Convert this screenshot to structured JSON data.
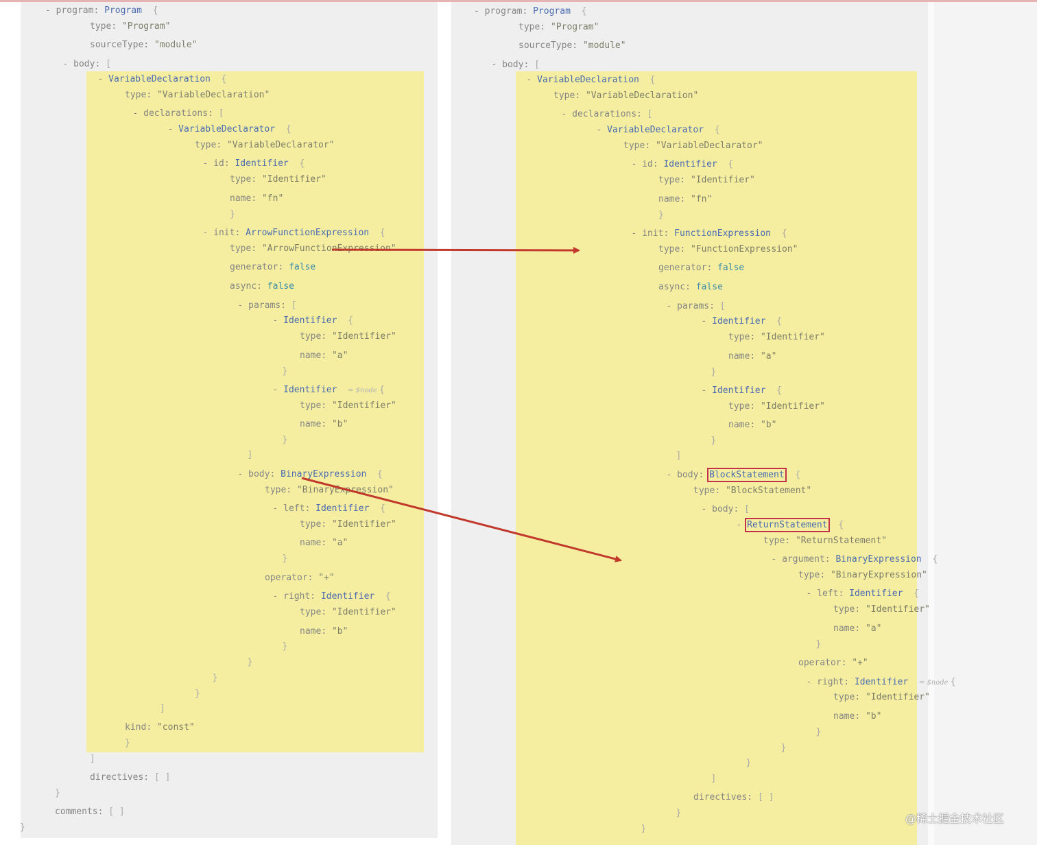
{
  "left_tree": [
    {
      "i": 0,
      "p": "- ",
      "k": "program",
      "t": "Program",
      "b": "{"
    },
    {
      "i": 1,
      "k": "type",
      "s": "\"Program\""
    },
    {
      "i": 1,
      "k": "sourceType",
      "s": "\"module\""
    },
    {
      "i": 0.5,
      "p": "- ",
      "k": "body",
      "b": "["
    },
    {
      "i": 1.5,
      "p": "- ",
      "t": "VariableDeclaration",
      "b": "{"
    },
    {
      "i": 2,
      "k": "type",
      "s": "\"VariableDeclaration\""
    },
    {
      "i": 2.5,
      "p": "- ",
      "k": "declarations",
      "b": "["
    },
    {
      "i": 3.5,
      "p": "- ",
      "t": "VariableDeclarator",
      "b": "{"
    },
    {
      "i": 4,
      "k": "type",
      "s": "\"VariableDeclarator\""
    },
    {
      "i": 4.5,
      "p": "- ",
      "k": "id",
      "t": "Identifier",
      "b": "{"
    },
    {
      "i": 5,
      "k": "type",
      "s": "\"Identifier\""
    },
    {
      "i": 5,
      "k": "name",
      "s": "\"fn\""
    },
    {
      "i": 5,
      "c": "}"
    },
    {
      "i": 4.5,
      "p": "- ",
      "k": "init",
      "t": "ArrowFunctionExpression",
      "b": "{"
    },
    {
      "i": 5,
      "k": "type",
      "s": "\"ArrowFunctionExpression\""
    },
    {
      "i": 5,
      "k": "generator",
      "v": "false"
    },
    {
      "i": 5,
      "k": "async",
      "v": "false"
    },
    {
      "i": 5.5,
      "p": "- ",
      "k": "params",
      "b": "["
    },
    {
      "i": 6.5,
      "p": "- ",
      "t": "Identifier",
      "b": "{"
    },
    {
      "i": 7,
      "k": "type",
      "s": "\"Identifier\""
    },
    {
      "i": 7,
      "k": "name",
      "s": "\"a\""
    },
    {
      "i": 6.5,
      "c": "}"
    },
    {
      "i": 6.5,
      "p": "- ",
      "t": "Identifier",
      "tag": "= $node",
      "b": "{"
    },
    {
      "i": 7,
      "k": "type",
      "s": "\"Identifier\""
    },
    {
      "i": 7,
      "k": "name",
      "s": "\"b\""
    },
    {
      "i": 6.5,
      "c": "}"
    },
    {
      "i": 5.5,
      "c": "]"
    },
    {
      "i": 5.5,
      "p": "- ",
      "k": "body",
      "t": "BinaryExpression",
      "b": "{"
    },
    {
      "i": 6,
      "k": "type",
      "s": "\"BinaryExpression\""
    },
    {
      "i": 6.5,
      "p": "- ",
      "k": "left",
      "t": "Identifier",
      "b": "{"
    },
    {
      "i": 7,
      "k": "type",
      "s": "\"Identifier\""
    },
    {
      "i": 7,
      "k": "name",
      "s": "\"a\""
    },
    {
      "i": 6.5,
      "c": "}"
    },
    {
      "i": 6,
      "k": "operator",
      "s": "\"+\""
    },
    {
      "i": 6.5,
      "p": "- ",
      "k": "right",
      "t": "Identifier",
      "b": "{"
    },
    {
      "i": 7,
      "k": "type",
      "s": "\"Identifier\""
    },
    {
      "i": 7,
      "k": "name",
      "s": "\"b\""
    },
    {
      "i": 6.5,
      "c": "}"
    },
    {
      "i": 5.5,
      "c": "}"
    },
    {
      "i": 4.5,
      "c": "}"
    },
    {
      "i": 4,
      "c": "}"
    },
    {
      "i": 3,
      "c": "]"
    },
    {
      "i": 2,
      "k": "kind",
      "s": "\"const\""
    },
    {
      "i": 2,
      "c": "}"
    },
    {
      "i": 1,
      "c": "]"
    },
    {
      "i": 1,
      "k": "directives",
      "e": "[ ]"
    },
    {
      "i": 0,
      "c": "}"
    },
    {
      "i": 0,
      "k": "comments",
      "e": "[ ]"
    },
    {
      "i": -1,
      "c": "}"
    }
  ],
  "right_tree": [
    {
      "i": 0,
      "p": "- ",
      "k": "program",
      "t": "Program",
      "b": "{"
    },
    {
      "i": 1,
      "k": "type",
      "s": "\"Program\""
    },
    {
      "i": 1,
      "k": "sourceType",
      "s": "\"module\""
    },
    {
      "i": 0.5,
      "p": "- ",
      "k": "body",
      "b": "["
    },
    {
      "i": 1.5,
      "p": "- ",
      "t": "VariableDeclaration",
      "b": "{"
    },
    {
      "i": 2,
      "k": "type",
      "s": "\"VariableDeclaration\""
    },
    {
      "i": 2.5,
      "p": "- ",
      "k": "declarations",
      "b": "["
    },
    {
      "i": 3.5,
      "p": "- ",
      "t": "VariableDeclarator",
      "b": "{"
    },
    {
      "i": 4,
      "k": "type",
      "s": "\"VariableDeclarator\""
    },
    {
      "i": 4.5,
      "p": "- ",
      "k": "id",
      "t": "Identifier",
      "b": "{"
    },
    {
      "i": 5,
      "k": "type",
      "s": "\"Identifier\""
    },
    {
      "i": 5,
      "k": "name",
      "s": "\"fn\""
    },
    {
      "i": 5,
      "c": "}"
    },
    {
      "i": 4.5,
      "p": "- ",
      "k": "init",
      "t": "FunctionExpression",
      "b": "{"
    },
    {
      "i": 5,
      "k": "type",
      "s": "\"FunctionExpression\""
    },
    {
      "i": 5,
      "k": "generator",
      "v": "false"
    },
    {
      "i": 5,
      "k": "async",
      "v": "false"
    },
    {
      "i": 5.5,
      "p": "- ",
      "k": "params",
      "b": "["
    },
    {
      "i": 6.5,
      "p": "- ",
      "t": "Identifier",
      "b": "{"
    },
    {
      "i": 7,
      "k": "type",
      "s": "\"Identifier\""
    },
    {
      "i": 7,
      "k": "name",
      "s": "\"a\""
    },
    {
      "i": 6.5,
      "c": "}"
    },
    {
      "i": 6.5,
      "p": "- ",
      "t": "Identifier",
      "b": "{"
    },
    {
      "i": 7,
      "k": "type",
      "s": "\"Identifier\""
    },
    {
      "i": 7,
      "k": "name",
      "s": "\"b\""
    },
    {
      "i": 6.5,
      "c": "}"
    },
    {
      "i": 5.5,
      "c": "]"
    },
    {
      "i": 5.5,
      "p": "- ",
      "k": "body",
      "t": "BlockStatement",
      "boxed": true,
      "b": "{"
    },
    {
      "i": 6,
      "k": "type",
      "s": "\"BlockStatement\""
    },
    {
      "i": 6.5,
      "p": "- ",
      "k": "body",
      "b": "["
    },
    {
      "i": 7.5,
      "p": "- ",
      "t": "ReturnStatement",
      "boxed": true,
      "b": "{"
    },
    {
      "i": 8,
      "k": "type",
      "s": "\"ReturnStatement\""
    },
    {
      "i": 8.5,
      "p": "- ",
      "k": "argument",
      "t": "BinaryExpression",
      "b": "{"
    },
    {
      "i": 9,
      "k": "type",
      "s": "\"BinaryExpression\""
    },
    {
      "i": 9.5,
      "p": "- ",
      "k": "left",
      "t": "Identifier",
      "b": "{"
    },
    {
      "i": 10,
      "k": "type",
      "s": "\"Identifier\""
    },
    {
      "i": 10,
      "k": "name",
      "s": "\"a\""
    },
    {
      "i": 9.5,
      "c": "}"
    },
    {
      "i": 9,
      "k": "operator",
      "s": "\"+\""
    },
    {
      "i": 9.5,
      "p": "- ",
      "k": "right",
      "t": "Identifier",
      "tag": "= $node",
      "b": "{"
    },
    {
      "i": 10,
      "k": "type",
      "s": "\"Identifier\""
    },
    {
      "i": 10,
      "k": "name",
      "s": "\"b\""
    },
    {
      "i": 9.5,
      "c": "}"
    },
    {
      "i": 8.5,
      "c": "}"
    },
    {
      "i": 7.5,
      "c": "}"
    },
    {
      "i": 6.5,
      "c": "]"
    },
    {
      "i": 6,
      "k": "directives",
      "e": "[ ]"
    },
    {
      "i": 5.5,
      "c": "}"
    },
    {
      "i": 4.5,
      "c": "}"
    },
    {
      "i": 3.5,
      "c": "}"
    }
  ],
  "watermark": "@稀土掘金技术社区",
  "colors": {
    "highlight": "#f5eea0",
    "panel": "#efefef",
    "arrow": "#c0392b",
    "box": "#c4304a",
    "type_name": "#4a6bb0"
  }
}
